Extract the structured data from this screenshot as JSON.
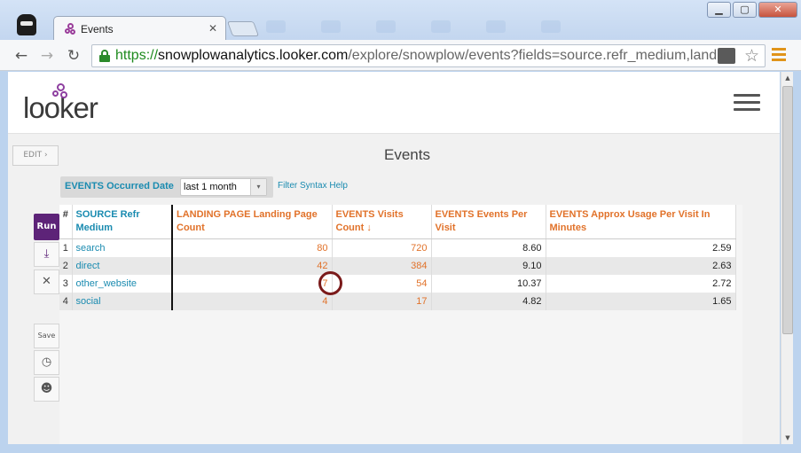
{
  "browser": {
    "tab_title": "Events",
    "tab_close": "✕",
    "url_scheme": "https://",
    "url_host": "snowplowanalytics.looker.com",
    "url_path": "/explore/snowplow/events?fields=source.refr_medium,landin",
    "back": "←",
    "forward": "→",
    "reload": "↻",
    "star": "☆",
    "minimize": "▁",
    "maximize": "▢",
    "close": "✕"
  },
  "header": {
    "logo": "looker"
  },
  "toolbar": {
    "edit_label": "EDIT ›",
    "page_title": "Events"
  },
  "filter": {
    "label": "EVENTS Occurred Date",
    "value": "last 1 month",
    "caret": "▾",
    "syntax_help": "Filter Syntax Help"
  },
  "sidebar": {
    "run_label": "Run",
    "download_icon": "⤓",
    "clear_icon": "✕",
    "save_label": "Save",
    "schedule_icon": "◷",
    "share_icon": "☻"
  },
  "table": {
    "columns": {
      "num": "#",
      "medium": "SOURCE Refr Medium",
      "landing": "LANDING PAGE Landing Page Count",
      "visits": "EVENTS Visits Count ↓",
      "events_per_visit": "EVENTS Events Per Visit",
      "usage": "EVENTS Approx Usage Per Visit In Minutes"
    },
    "rows": [
      {
        "num": "1",
        "medium": "search",
        "landing": "80",
        "visits": "720",
        "events_per_visit": "8.60",
        "usage": "2.59"
      },
      {
        "num": "2",
        "medium": "direct",
        "landing": "42",
        "visits": "384",
        "events_per_visit": "9.10",
        "usage": "2.63"
      },
      {
        "num": "3",
        "medium": "other_website",
        "landing": "7",
        "visits": "54",
        "events_per_visit": "10.37",
        "usage": "2.72"
      },
      {
        "num": "4",
        "medium": "social",
        "landing": "4",
        "visits": "17",
        "events_per_visit": "4.82",
        "usage": "1.65"
      }
    ]
  },
  "scrollbar": {
    "up": "▲",
    "down": "▼"
  },
  "colors": {
    "accent": "#5d2378",
    "dimension": "#1a8bb0",
    "measure": "#e1722a"
  }
}
